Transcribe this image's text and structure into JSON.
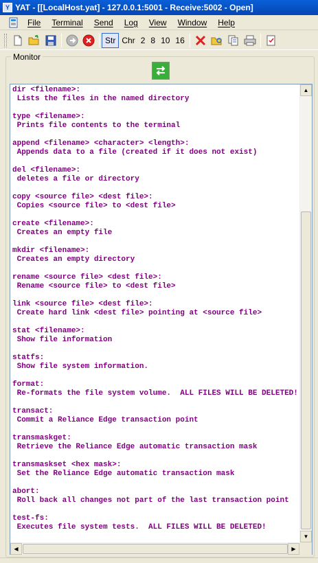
{
  "window": {
    "title": "YAT - [[LocalHost.yat] - 127.0.0.1:5001 - Receive:5002 - Open]",
    "icon": "yat-app-icon"
  },
  "menubar": {
    "icon": "document-icon",
    "items": [
      "File",
      "Terminal",
      "Send",
      "Log",
      "View",
      "Window",
      "Help"
    ]
  },
  "toolbar": {
    "buttons": [
      {
        "name": "new-file-icon"
      },
      {
        "name": "open-folder-icon"
      },
      {
        "name": "save-disk-icon"
      },
      {
        "name": "connect-icon"
      },
      {
        "name": "disconnect-icon"
      }
    ],
    "radix": [
      "Str",
      "Chr",
      "2",
      "8",
      "10",
      "16"
    ],
    "radix_active": "Str",
    "right_buttons": [
      {
        "name": "clear-red-x-icon"
      },
      {
        "name": "find-icon"
      },
      {
        "name": "copy-icon"
      },
      {
        "name": "print-icon"
      },
      {
        "name": "format-icon"
      }
    ]
  },
  "monitor": {
    "label": "Monitor",
    "swap_icon": "swap-arrows-icon",
    "lines": [
      {
        "cmd": "dir <filename>:",
        "desc": " Lists the files in the named directory"
      },
      {
        "cmd": "type <filename>:",
        "desc": " Prints file contents to the terminal"
      },
      {
        "cmd": "append <filename> <character> <length>:",
        "desc": " Appends data to a file (created if it does not exist)"
      },
      {
        "cmd": "del <filename>:",
        "desc": " deletes a file or directory"
      },
      {
        "cmd": "copy <source file> <dest file>:",
        "desc": " Copies <source file> to <dest file>"
      },
      {
        "cmd": "create <filename>:",
        "desc": " Creates an empty file"
      },
      {
        "cmd": "mkdir <filename>:",
        "desc": " Creates an empty directory"
      },
      {
        "cmd": "rename <source file> <dest file>:",
        "desc": " Rename <source file> to <dest file>"
      },
      {
        "cmd": "link <source file> <dest file>:",
        "desc": " Create hard link <dest file> pointing at <source file>"
      },
      {
        "cmd": "stat <filename>:",
        "desc": " Show file information"
      },
      {
        "cmd": "statfs:",
        "desc": " Show file system information."
      },
      {
        "cmd": "format:",
        "desc": " Re-formats the file system volume.  ALL FILES WILL BE DELETED!"
      },
      {
        "cmd": "transact:",
        "desc": " Commit a Reliance Edge transaction point"
      },
      {
        "cmd": "transmaskget:",
        "desc": " Retrieve the Reliance Edge automatic transaction mask"
      },
      {
        "cmd": "transmaskset <hex mask>:",
        "desc": " Set the Reliance Edge automatic transaction mask"
      },
      {
        "cmd": "abort:",
        "desc": " Roll back all changes not part of the last transaction point"
      },
      {
        "cmd": "test-fs:",
        "desc": " Executes file system tests.  ALL FILES WILL BE DELETED!"
      }
    ]
  },
  "colors": {
    "monitor_text": "#800080",
    "titlebar": "#0a5fd8"
  }
}
